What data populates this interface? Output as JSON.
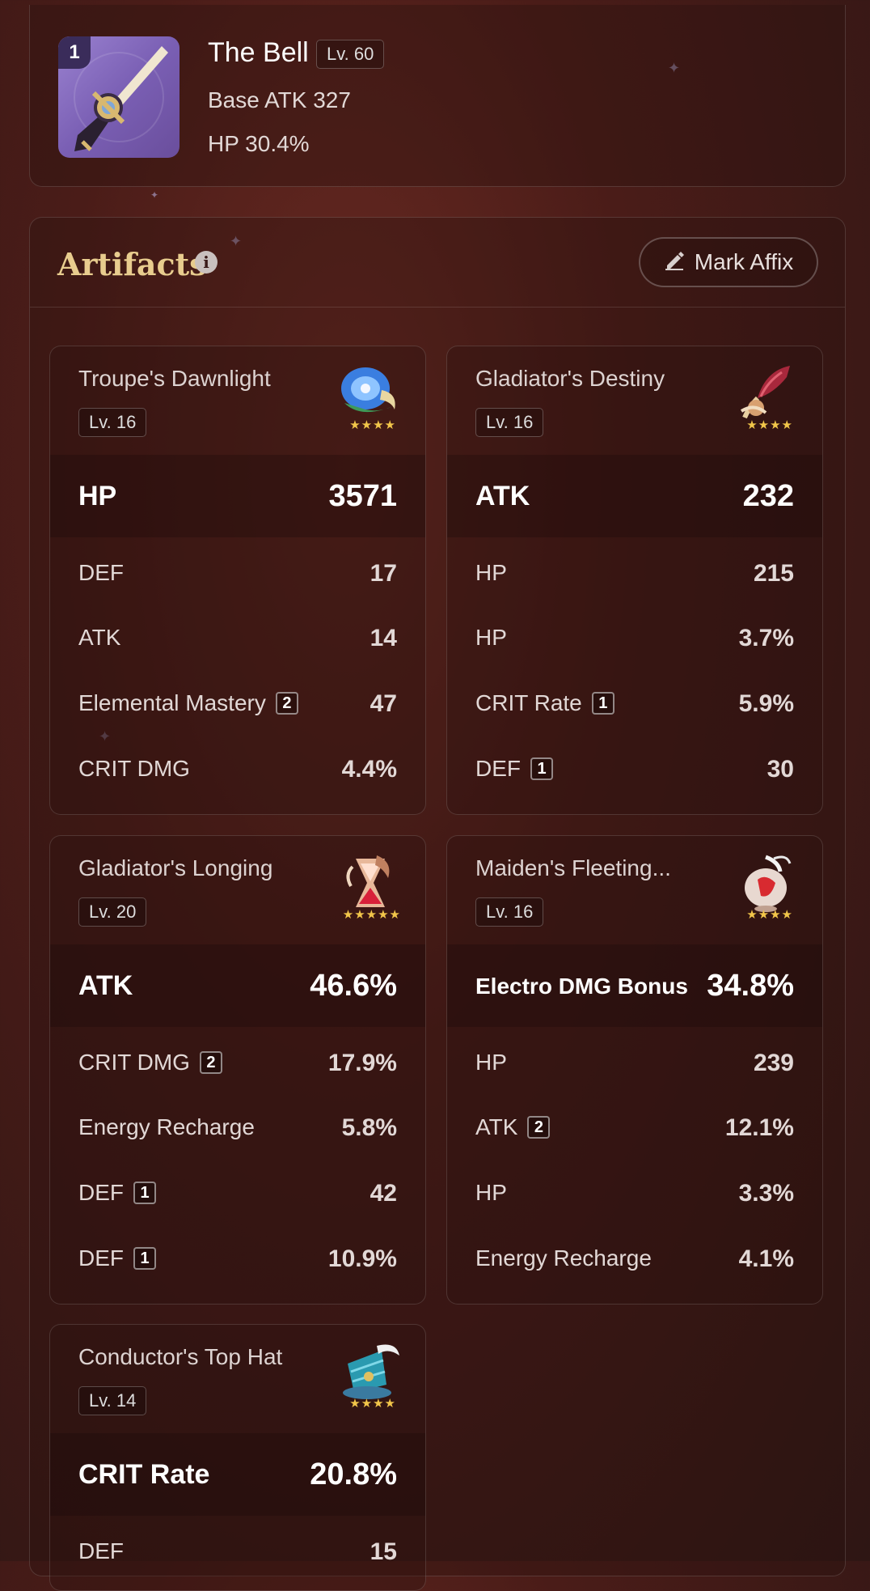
{
  "weapon": {
    "refinement": "1",
    "name": "The Bell",
    "level": "Lv. 60",
    "base_atk": "Base ATK 327",
    "substat": "HP 30.4%"
  },
  "artifacts_section": {
    "title": "Artifacts",
    "info_icon": "i",
    "mark_affix_label": "Mark Affix"
  },
  "artifacts": [
    {
      "name": "Troupe's Dawnlight",
      "level": "Lv. 16",
      "stars": "★★★★",
      "main": {
        "name": "HP",
        "value": "3571"
      },
      "subs": [
        {
          "name": "DEF",
          "value": "17",
          "roll": ""
        },
        {
          "name": "ATK",
          "value": "14",
          "roll": ""
        },
        {
          "name": "Elemental Mastery",
          "value": "47",
          "roll": "2"
        },
        {
          "name": "CRIT DMG",
          "value": "4.4%",
          "roll": ""
        }
      ]
    },
    {
      "name": "Gladiator's Destiny",
      "level": "Lv. 16",
      "stars": "★★★★",
      "main": {
        "name": "ATK",
        "value": "232"
      },
      "subs": [
        {
          "name": "HP",
          "value": "215",
          "roll": ""
        },
        {
          "name": "HP",
          "value": "3.7%",
          "roll": ""
        },
        {
          "name": "CRIT Rate",
          "value": "5.9%",
          "roll": "1"
        },
        {
          "name": "DEF",
          "value": "30",
          "roll": "1"
        }
      ]
    },
    {
      "name": "Gladiator's Longing",
      "level": "Lv. 20",
      "stars": "★★★★★",
      "main": {
        "name": "ATK",
        "value": "46.6%"
      },
      "subs": [
        {
          "name": "CRIT DMG",
          "value": "17.9%",
          "roll": "2"
        },
        {
          "name": "Energy Recharge",
          "value": "5.8%",
          "roll": ""
        },
        {
          "name": "DEF",
          "value": "42",
          "roll": "1"
        },
        {
          "name": "DEF",
          "value": "10.9%",
          "roll": "1"
        }
      ]
    },
    {
      "name": "Maiden's Fleeting...",
      "level": "Lv. 16",
      "stars": "★★★★",
      "main": {
        "name": "Electro DMG Bonus",
        "value": "34.8%"
      },
      "subs": [
        {
          "name": "HP",
          "value": "239",
          "roll": ""
        },
        {
          "name": "ATK",
          "value": "12.1%",
          "roll": "2"
        },
        {
          "name": "HP",
          "value": "3.3%",
          "roll": ""
        },
        {
          "name": "Energy Recharge",
          "value": "4.1%",
          "roll": ""
        }
      ]
    },
    {
      "name": "Conductor's Top Hat",
      "level": "Lv. 14",
      "stars": "★★★★",
      "main": {
        "name": "CRIT Rate",
        "value": "20.8%"
      },
      "subs": [
        {
          "name": "DEF",
          "value": "15",
          "roll": ""
        }
      ]
    }
  ],
  "icons": {
    "weapon": "claymore-icon",
    "info": "info-icon",
    "mark": "pencil-icon",
    "flower": "flower-of-life-icon",
    "plume": "plume-of-death-icon",
    "sands": "sands-of-eon-icon",
    "goblet": "goblet-of-eonothem-icon",
    "circlet": "circlet-of-logos-icon"
  },
  "colors": {
    "accent_gold": "#e8cc8e",
    "star": "#f2c64a",
    "background": "#4a1c18"
  }
}
